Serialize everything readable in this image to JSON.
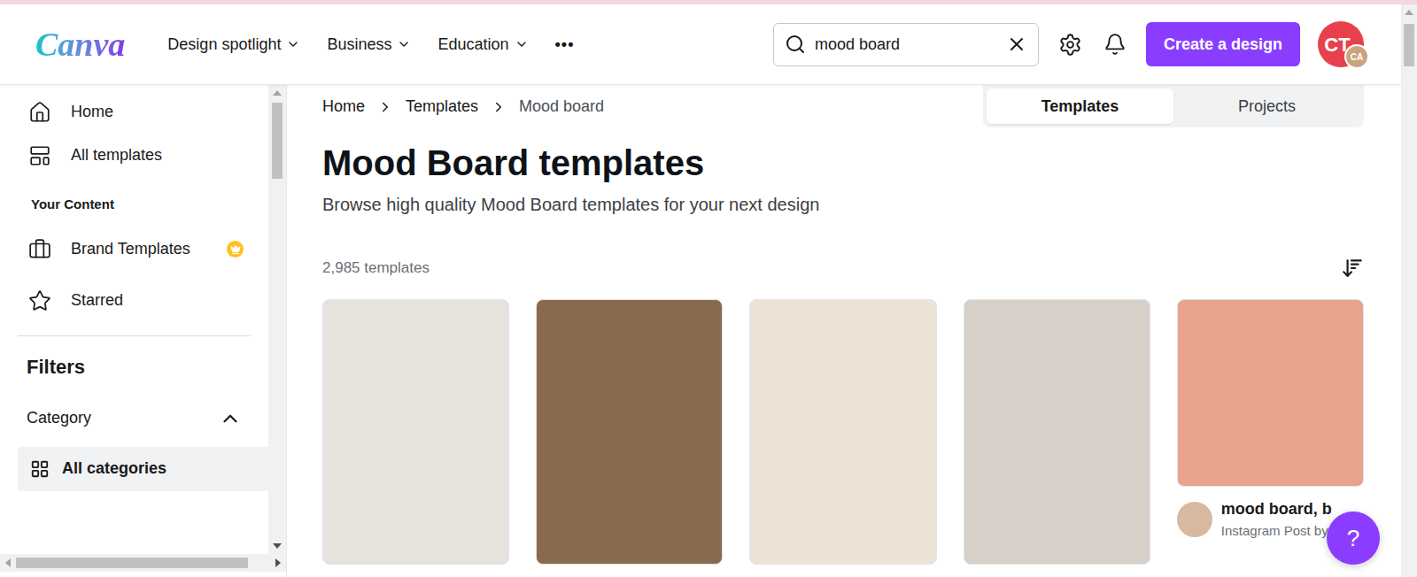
{
  "header": {
    "logo": "Canva",
    "nav": [
      {
        "label": "Design spotlight"
      },
      {
        "label": "Business"
      },
      {
        "label": "Education"
      }
    ],
    "more": "•••",
    "search": {
      "value": "mood board"
    },
    "create_button": "Create a design",
    "avatar": {
      "initials": "CT",
      "badge": "CA"
    }
  },
  "sidebar": {
    "items": [
      {
        "label": "Home",
        "icon": "home",
        "selected": false
      },
      {
        "label": "All templates",
        "icon": "templates",
        "selected": false
      }
    ],
    "section": "Your Content",
    "content_items": [
      {
        "label": "Brand Templates",
        "icon": "brand",
        "premium": true
      },
      {
        "label": "Starred",
        "icon": "star",
        "premium": false
      }
    ],
    "filters_title": "Filters",
    "category": {
      "label": "Category",
      "expanded": true,
      "options": [
        {
          "label": "All categories",
          "selected": true
        }
      ]
    }
  },
  "breadcrumb": [
    "Home",
    "Templates",
    "Mood board"
  ],
  "view_tabs": [
    {
      "label": "Templates",
      "selected": true
    },
    {
      "label": "Projects",
      "selected": false
    }
  ],
  "title": "Mood Board templates",
  "subtitle": "Browse high quality Mood Board templates for your next design",
  "count": "2,985 templates",
  "templates": [
    {
      "kind": "image"
    },
    {
      "kind": "image"
    },
    {
      "kind": "image"
    },
    {
      "kind": "image"
    },
    {
      "kind": "captioned",
      "title": "mood board, b",
      "subtitle": "Instagram Post by"
    }
  ],
  "help_button": "?"
}
